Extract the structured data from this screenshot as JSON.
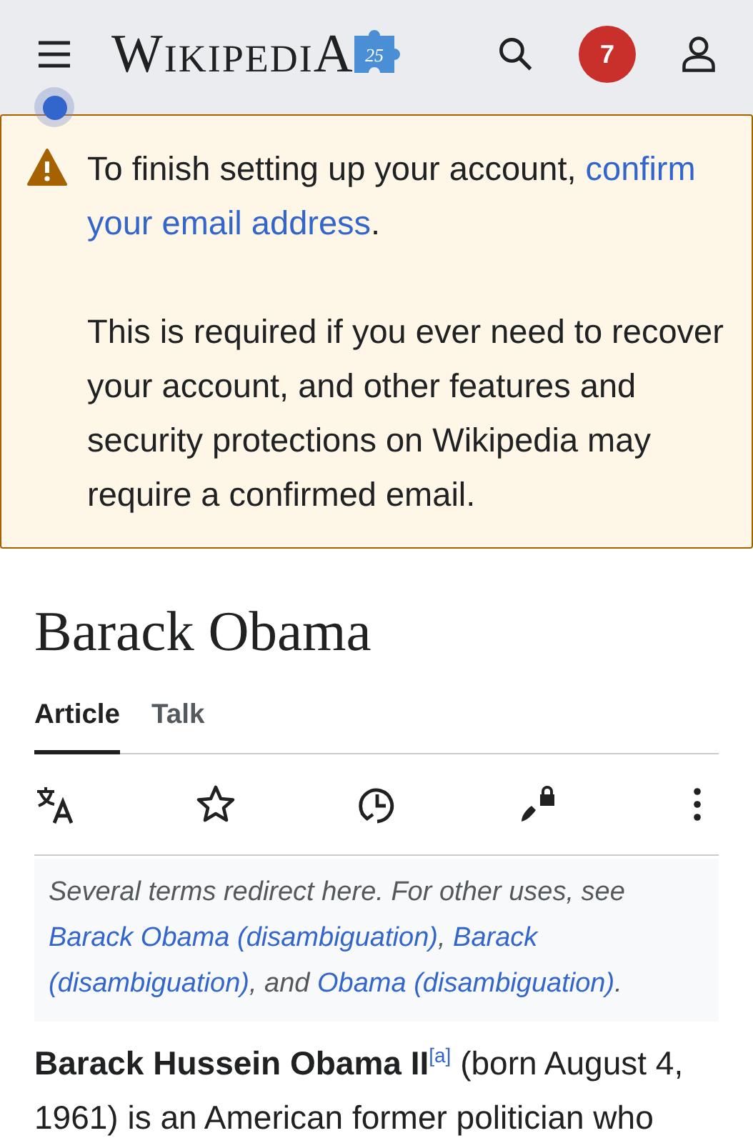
{
  "header": {
    "wordmark": "WikipediA",
    "logo_badge": "25",
    "notifications": "7"
  },
  "notice": {
    "paragraphs": [
      [
        {
          "text": "To finish setting up your account, ",
          "kind": "text"
        },
        {
          "text": "confirm",
          "kind": "link"
        },
        {
          "text": "your email address",
          "kind": "link"
        },
        {
          "text": ".",
          "kind": "text"
        }
      ],
      [
        {
          "text": "This is required if you ever need to recover your account, and other features and security protections on Wikipedia may require a confirmed email.",
          "kind": "text"
        }
      ]
    ]
  },
  "page_title": "Barack Obama",
  "tabs": [
    {
      "label": "Article",
      "selected": true
    },
    {
      "label": "Talk",
      "selected": false
    }
  ],
  "hatnote": [
    {
      "text": "Several terms redirect here. For other uses, see ",
      "kind": "text"
    },
    {
      "text": "Barack Obama (disambiguation)",
      "kind": "link"
    },
    {
      "text": ", ",
      "kind": "text"
    },
    {
      "text": "Barack",
      "kind": "link"
    },
    {
      "text": "(disambiguation)",
      "kind": "link"
    },
    {
      "text": ", and ",
      "kind": "text"
    },
    {
      "text": "Obama (disambiguation)",
      "kind": "link"
    },
    {
      "text": ".",
      "kind": "text"
    }
  ],
  "lead": [
    {
      "text": "**Barack Hussein Obama II**",
      "kind": "text"
    },
    {
      "text": "[a]",
      "kind": "footnote"
    },
    {
      "text": " (born August 4, 1961) is an American former politician who",
      "kind": "text"
    }
  ]
}
